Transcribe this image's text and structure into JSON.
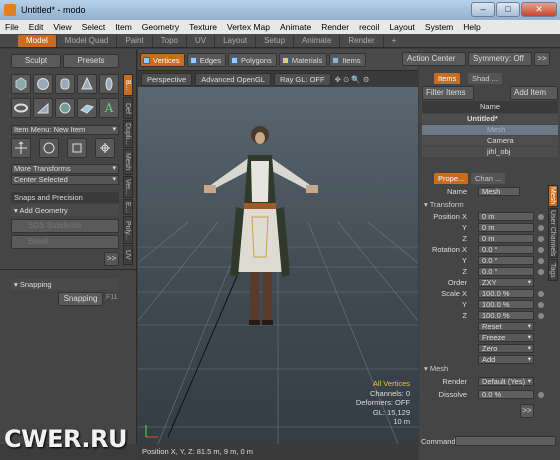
{
  "window": {
    "title": "Untitled* - modo",
    "min": "–",
    "max": "□",
    "close": "✕"
  },
  "menu": [
    "File",
    "Edit",
    "View",
    "Select",
    "Item",
    "Geometry",
    "Texture",
    "Vertex Map",
    "Animate",
    "Render",
    "recoil",
    "Layout",
    "System",
    "Help"
  ],
  "tabs": [
    "Model",
    "Model Quad",
    "Paint",
    "Topo",
    "UV",
    "Layout",
    "Setup",
    "Animate",
    "Render",
    "+"
  ],
  "active_tab": "Model",
  "left": {
    "sculpt": "Sculpt",
    "presets": "Presets",
    "item_menu": "Item Menu: New Item",
    "more_transforms": "More Transforms",
    "center_selected": "Center Selected",
    "snaps_precision": "Snaps and Precision",
    "add_geometry": "Add Geometry",
    "sds_subdivide": "SDS Subdivide",
    "bevel": "Bevel",
    "expand": ">>",
    "snapping_section": "Snapping",
    "snapping_btn": "Snapping",
    "snapping_key": "F11",
    "vtabs": [
      "B...",
      "Def",
      "Dupli...",
      "Mesh",
      "Ver...",
      "E...",
      "Poly...",
      "UV"
    ]
  },
  "viewport": {
    "modes": [
      "Vertices",
      "Edges",
      "Polygons",
      "Materials",
      "Items"
    ],
    "active_mode": "Vertices",
    "camera": "Perspective",
    "shading": "Advanced OpenGL",
    "raygl": "Ray GL: OFF",
    "stats": {
      "label": "All Vertices",
      "channels": "Channels: 0",
      "deformers": "Deformers: OFF",
      "gl": "GL: 15,129",
      "unit": "10 m"
    },
    "status": "Position X, Y, Z:  81.5 m, 9 m, 0 m"
  },
  "top_right": {
    "min": "–",
    "max": "□",
    "close": "✕",
    "action_center": "Action Center",
    "symmetry": "Symmetry: Off",
    "expand": ">>"
  },
  "items_panel": {
    "tabs": [
      "Items",
      "Shad ..."
    ],
    "filter": "Filter Items",
    "add_item": "Add Item",
    "col_name": "Name",
    "rows": [
      "Untitled*",
      "Mesh",
      "Camera",
      "jihl_obj"
    ]
  },
  "props": {
    "tabs": [
      "Prope...",
      "Chan ..."
    ],
    "name_label": "Name",
    "name_value": "Mesh",
    "transform_section": "Transform",
    "rows": [
      {
        "label": "Position X",
        "value": "0 m"
      },
      {
        "label": "Y",
        "value": "0 m"
      },
      {
        "label": "Z",
        "value": "0 m"
      },
      {
        "label": "Rotation X",
        "value": "0.0 °"
      },
      {
        "label": "Y",
        "value": "0.0 °"
      },
      {
        "label": "Z",
        "value": "0.0 °"
      },
      {
        "label": "Order",
        "value": "ZXY"
      },
      {
        "label": "Scale X",
        "value": "100.0 %"
      },
      {
        "label": "Y",
        "value": "100.0 %"
      },
      {
        "label": "Z",
        "value": "100.0 %"
      }
    ],
    "actions": [
      "Reset",
      "Freeze",
      "Zero",
      "Add"
    ],
    "mesh_section": "Mesh",
    "render_label": "Render",
    "render_value": "Default (Yes)",
    "dissolve_label": "Dissolve",
    "dissolve_value": "0.0 %",
    "expand": ">>",
    "vtabs": [
      "Mesh",
      "User Channels",
      "Tags"
    ]
  },
  "command": {
    "label": "Command",
    "value": ""
  },
  "watermark": "CWER.RU"
}
